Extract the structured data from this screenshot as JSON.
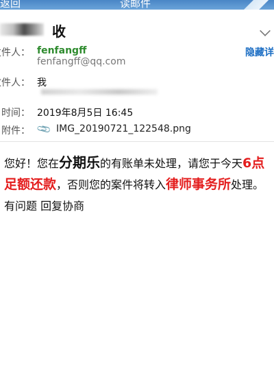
{
  "header": {
    "back_label": "返回",
    "title": "读邮件"
  },
  "subject": "收",
  "sender": {
    "label": "发件人：",
    "name": "fenfangff",
    "email": "fenfangff@qq.com",
    "hide_details": "隐藏详"
  },
  "recipient": {
    "label": "收件人：",
    "value": "我"
  },
  "date": {
    "label": "时间：",
    "value": "2019年8月5日 16:45"
  },
  "attachment": {
    "label": "附件：",
    "icon": "paperclip-icon",
    "filename": "IMG_20190721_122548.png"
  },
  "message": {
    "p1": "您好！您在",
    "brand": "分期乐",
    "p2": "的有账单未处理，请您于今天",
    "time": "6点",
    "p3": "足额还款",
    "p4": "，否则您的案件将转入",
    "firm": "律师事务所",
    "p5": "处理。有问题 回复协商"
  },
  "colors": {
    "header_bg": "#4a86c6",
    "sender_green": "#2e8b2e",
    "link_blue": "#1e6fc4",
    "alert_red": "#e41d1d"
  }
}
